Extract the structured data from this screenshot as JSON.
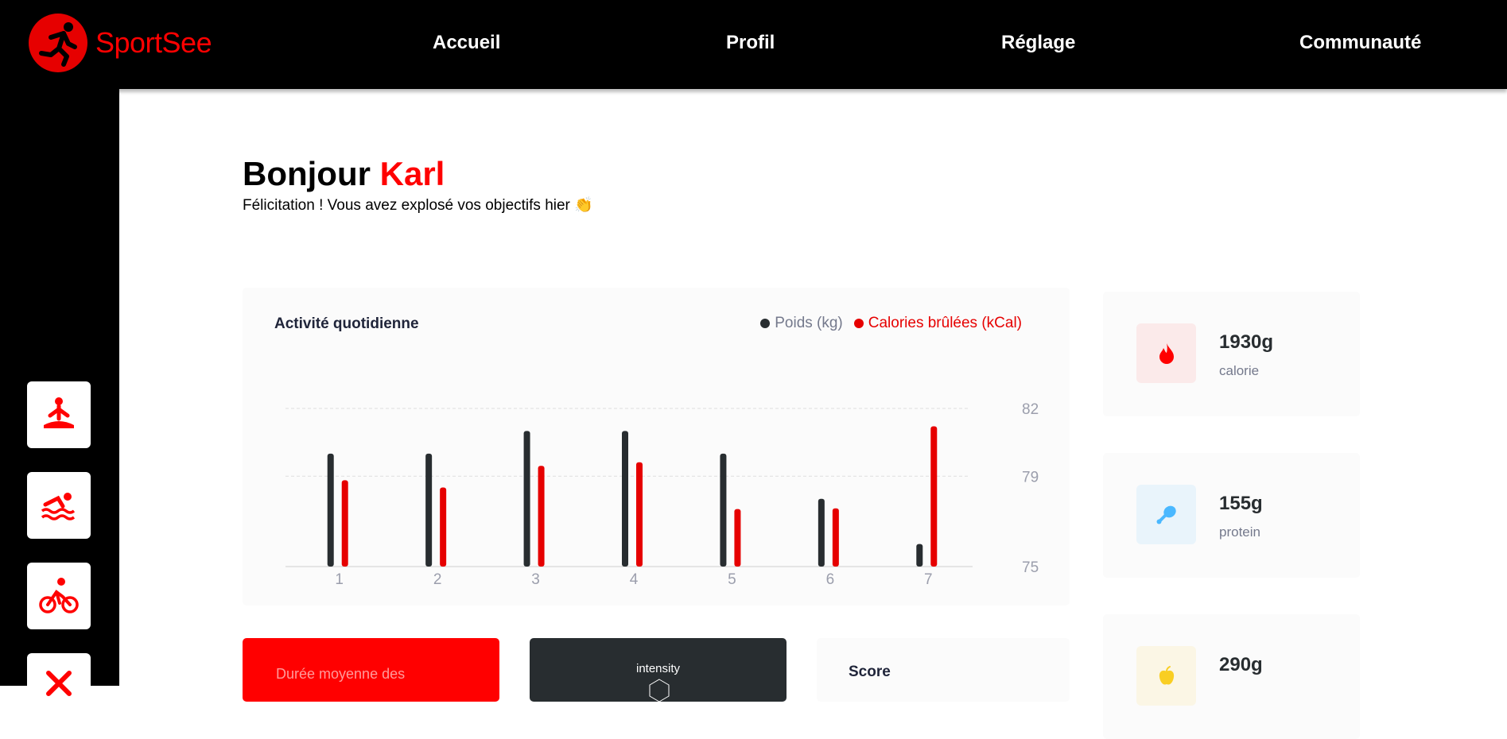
{
  "app": {
    "name": "SportSee",
    "brand_color": "#ff0101"
  },
  "nav": {
    "items": [
      {
        "label": "Accueil"
      },
      {
        "label": "Profil"
      },
      {
        "label": "Réglage"
      },
      {
        "label": "Communauté"
      }
    ]
  },
  "sidebar": {
    "items": [
      {
        "icon": "yoga-icon"
      },
      {
        "icon": "swimming-icon"
      },
      {
        "icon": "cycling-icon"
      },
      {
        "icon": "weightlifting-icon"
      }
    ]
  },
  "greeting": {
    "hello": "Bonjour",
    "name": "Karl",
    "message": "Félicitation ! Vous avez explosé vos objectifs hier 👏"
  },
  "activity": {
    "title": "Activité quotidienne",
    "legend": {
      "weight": "Poids (kg)",
      "calories": "Calories brûlées (kCal)"
    }
  },
  "chart_data": {
    "type": "bar",
    "title": "Activité quotidienne",
    "categories": [
      "1",
      "2",
      "3",
      "4",
      "5",
      "6",
      "7"
    ],
    "series": [
      {
        "name": "Poids (kg)",
        "color": "#282d30",
        "values": [
          80,
          80,
          81,
          81,
          80,
          78,
          76
        ]
      },
      {
        "name": "Calories brûlées (kCal)",
        "color": "#e60000",
        "values": [
          240,
          220,
          280,
          290,
          160,
          162,
          390
        ]
      }
    ],
    "y_ticks": [
      75,
      79,
      82
    ],
    "ylim": [
      75,
      82
    ],
    "grid": "horizontal dashed",
    "legend_position": "top-right"
  },
  "key_data": [
    {
      "value": "1930g",
      "label": "calorie",
      "icon": "fire-icon",
      "color": "#ff0000",
      "bg": "#fbeaea"
    },
    {
      "value": "155g",
      "label": "protein",
      "icon": "chicken-icon",
      "color": "#4ab8ff",
      "bg": "#e9f4fb"
    },
    {
      "value": "290g",
      "label": "",
      "icon": "apple-icon",
      "color": "#f9ce23",
      "bg": "#fbf6e5"
    }
  ],
  "cards": {
    "duration_title": "Durée moyenne des",
    "intensity_label": "intensity",
    "score_title": "Score"
  }
}
